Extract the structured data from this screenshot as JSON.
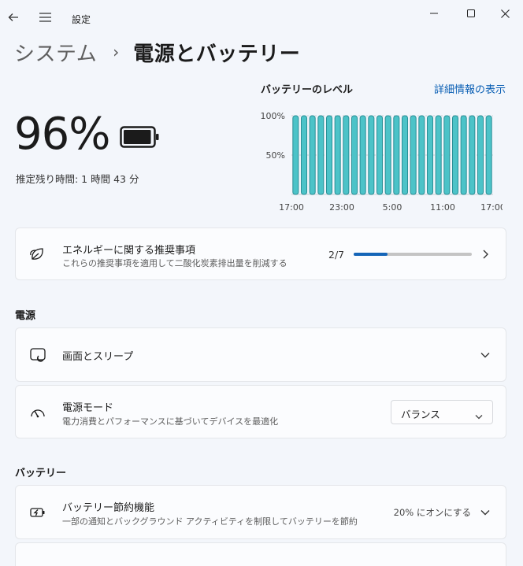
{
  "app": {
    "title": "設定"
  },
  "breadcrumb": {
    "parent": "システム",
    "separator": "›",
    "current": "電源とバッテリー"
  },
  "battery": {
    "percent": "96%",
    "remaining": "推定残り時間: 1 時間 43 分",
    "charge_level": 0.96
  },
  "battery_level": {
    "title": "バッテリーのレベル",
    "details_link": "詳細情報の表示"
  },
  "chart_data": {
    "type": "bar",
    "title": "バッテリーのレベル",
    "ytick_labels": [
      "100%",
      "50%"
    ],
    "yticks": [
      100,
      50
    ],
    "xtick_labels": [
      "17:00",
      "23:00",
      "5:00",
      "11:00",
      "17:00"
    ],
    "ylim": [
      0,
      100
    ],
    "values": [
      100,
      100,
      100,
      100,
      100,
      100,
      100,
      100,
      100,
      100,
      100,
      100,
      100,
      100,
      100,
      100,
      100,
      100,
      100,
      100,
      100,
      100,
      100,
      100
    ],
    "grid": true,
    "colors": {
      "bar_fill": "#4cc3c8",
      "bar_stroke": "#2a8f96"
    }
  },
  "recommendation": {
    "title": "エネルギーに関する推奨事項",
    "subtitle": "これらの推奨事項を適用して二酸化炭素排出量を削減する",
    "progress_text": "2/7",
    "progress": 0.2857
  },
  "power_section": {
    "label": "電源"
  },
  "screen_sleep": {
    "title": "画面とスリープ"
  },
  "power_mode": {
    "title": "電源モード",
    "subtitle": "電力消費とパフォーマンスに基づいてデバイスを最適化",
    "selected": "バランス"
  },
  "battery_section": {
    "label": "バッテリー"
  },
  "battery_saver": {
    "title": "バッテリー節約機能",
    "subtitle": "一部の通知とバックグラウンド アクティビティを制限してバッテリーを節約",
    "status": "20% にオンにする"
  },
  "colors": {
    "accent": "#1565b8",
    "link": "#0a5fb4",
    "background": "#f3f6fb"
  }
}
